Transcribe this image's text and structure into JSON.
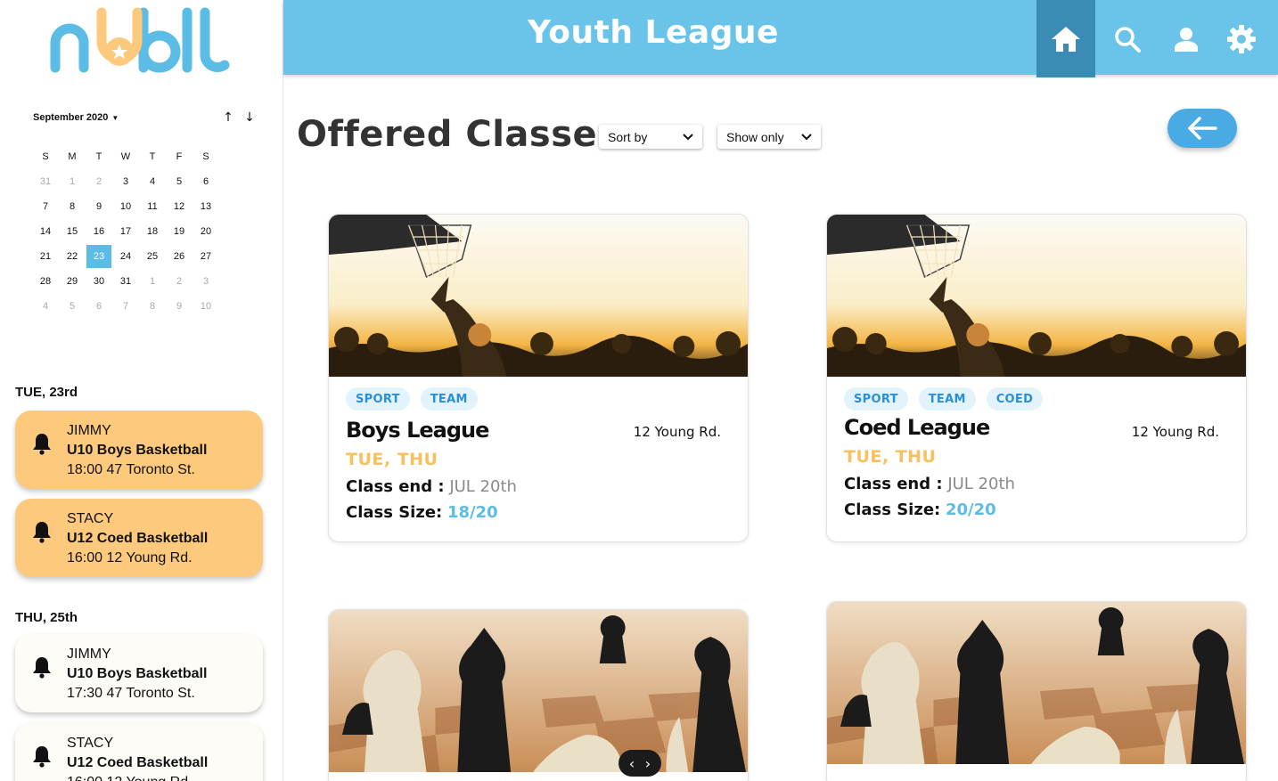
{
  "app": {
    "logo_text": "nubl"
  },
  "topbar": {
    "title": "Youth League",
    "accent": "#6ac4ea",
    "active_btn": "#3a8bb5",
    "icons": [
      "home-icon",
      "search-icon",
      "user-icon",
      "gear-icon"
    ]
  },
  "calendar": {
    "month": "September 2020",
    "weekdays": [
      "S",
      "M",
      "T",
      "W",
      "T",
      "F",
      "S"
    ],
    "weeks": [
      [
        [
          "31",
          true
        ],
        [
          "1",
          true
        ],
        [
          "2",
          true
        ],
        [
          "3",
          false
        ],
        [
          "4",
          false
        ],
        [
          "5",
          false
        ],
        [
          "6",
          false
        ]
      ],
      [
        [
          "7",
          false
        ],
        [
          "8",
          false
        ],
        [
          "9",
          false
        ],
        [
          "10",
          false
        ],
        [
          "11",
          false
        ],
        [
          "12",
          false
        ],
        [
          "13",
          false
        ]
      ],
      [
        [
          "14",
          false
        ],
        [
          "15",
          false
        ],
        [
          "16",
          false
        ],
        [
          "17",
          false
        ],
        [
          "18",
          false
        ],
        [
          "19",
          false
        ],
        [
          "20",
          false
        ]
      ],
      [
        [
          "21",
          false
        ],
        [
          "22",
          false
        ],
        [
          "23",
          false
        ],
        [
          "24",
          false
        ],
        [
          "25",
          false
        ],
        [
          "26",
          false
        ],
        [
          "27",
          false
        ]
      ],
      [
        [
          "28",
          false
        ],
        [
          "29",
          false
        ],
        [
          "30",
          false
        ],
        [
          "31",
          false
        ],
        [
          "1",
          true
        ],
        [
          "2",
          true
        ],
        [
          "3",
          true
        ]
      ],
      [
        [
          "4",
          true
        ],
        [
          "5",
          true
        ],
        [
          "6",
          true
        ],
        [
          "7",
          true
        ],
        [
          "8",
          true
        ],
        [
          "9",
          true
        ],
        [
          "10",
          true
        ]
      ]
    ],
    "selected": "23"
  },
  "schedule": [
    {
      "day": "TUE, 23rd",
      "events": [
        {
          "who": "JIMMY",
          "what": "U10 Boys Basketball",
          "when": "18:00 47 Toronto St.",
          "highlight": true
        },
        {
          "who": "STACY",
          "what": "U12 Coed Basketball",
          "when": "16:00 12 Young Rd.",
          "highlight": true
        }
      ]
    },
    {
      "day": "THU, 25th",
      "events": [
        {
          "who": "JIMMY",
          "what": "U10 Boys Basketball",
          "when": "17:30 47 Toronto St.",
          "highlight": false
        },
        {
          "who": "STACY",
          "what": "U12 Coed Basketball",
          "when": "16:00 12 Young Rd.",
          "highlight": false
        }
      ]
    }
  ],
  "main": {
    "title": "Offered Classes",
    "sort_label": "Sort by",
    "filter_label": "Show only"
  },
  "classes": [
    {
      "tags": [
        "SPORT",
        "TEAM"
      ],
      "title": "Boys League",
      "address": "12 Young Rd.",
      "days": "TUE, THU",
      "end_label": "Class end :",
      "end_value": "JUL 20th",
      "size_label": "Class Size:",
      "size_value": "18/20",
      "image": "basketball"
    },
    {
      "tags": [
        "SPORT",
        "TEAM",
        "COED"
      ],
      "title": "Coed League",
      "address": "12 Young Rd.",
      "days": "TUE, THU",
      "end_label": "Class end :",
      "end_value": "JUL 20th",
      "size_label": "Class Size:",
      "size_value": "20/20",
      "image": "basketball"
    },
    {
      "image": "chess"
    },
    {
      "image": "chess"
    }
  ]
}
